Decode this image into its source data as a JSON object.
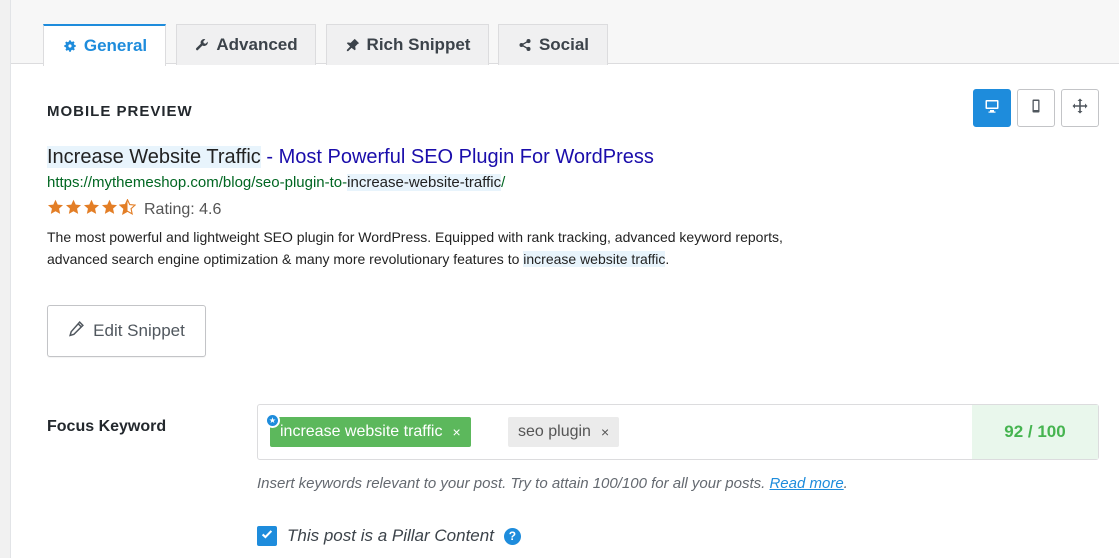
{
  "tabs": [
    {
      "label": "General",
      "icon": "gear-icon",
      "active": true
    },
    {
      "label": "Advanced",
      "icon": "wrench-icon",
      "active": false
    },
    {
      "label": "Rich Snippet",
      "icon": "pin-icon",
      "active": false
    },
    {
      "label": "Social",
      "icon": "share-icon",
      "active": false
    }
  ],
  "preview": {
    "section_title": "MOBILE PREVIEW",
    "view_buttons": [
      {
        "icon": "desktop-icon",
        "active": true
      },
      {
        "icon": "mobile-icon",
        "active": false
      },
      {
        "icon": "move-icon",
        "active": false
      }
    ],
    "title_highlight": "Increase Website Traffic",
    "title_rest": " - Most Powerful SEO Plugin For WordPress",
    "url_prefix": "https://mythemeshop.com/blog/seo-plugin-to-",
    "url_highlight": "increase-website-traffic",
    "url_suffix": "/",
    "rating_label": "Rating: 4.6",
    "rating_value": 4.6,
    "rating_max": 5,
    "desc_part1": "The most powerful and lightweight SEO plugin for WordPress. Equipped with rank tracking, advanced keyword reports, advanced search engine optimization & many more revolutionary features to ",
    "desc_highlight": "increase website traffic",
    "desc_end": "."
  },
  "edit_snippet": {
    "label": "Edit Snippet",
    "icon": "pencil-icon"
  },
  "focus_keyword": {
    "label": "Focus Keyword",
    "keywords": [
      {
        "text": "increase website traffic",
        "primary": true
      },
      {
        "text": "seo plugin",
        "primary": false
      }
    ],
    "remove_glyph": "×",
    "score": "92 / 100",
    "hint": "Insert keywords relevant to your post. Try to attain 100/100 for all your posts. ",
    "hint_link": "Read more",
    "hint_end": "."
  },
  "pillar": {
    "label": "This post is a Pillar Content",
    "checked": true,
    "help_glyph": "?"
  },
  "colors": {
    "accent": "#1e8cdc",
    "star": "#e37e26",
    "primary_chip": "#5cb85c",
    "score_text": "#46b450",
    "score_bg": "#e9f7ec",
    "serp_title": "#1a0dab",
    "serp_url": "#006621"
  }
}
